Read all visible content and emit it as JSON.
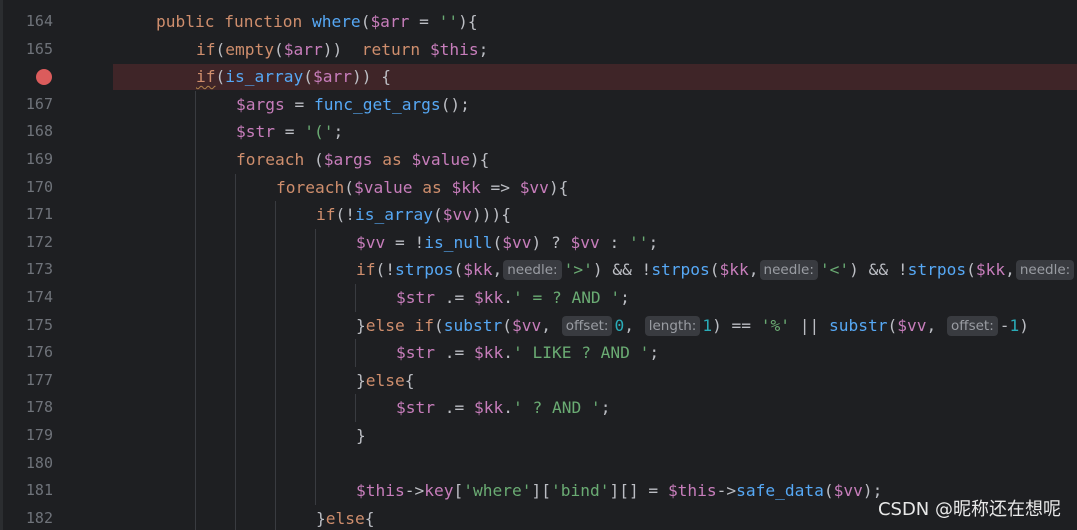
{
  "watermark": "CSDN @昵称还在想呢",
  "colors": {
    "background": "#1e1f22",
    "keyword": "#cf8e6d",
    "function": "#56a8f5",
    "variable": "#c77dbb",
    "string": "#6aab73",
    "number": "#2aacb8",
    "text": "#bcbec4",
    "line_number": "#6f737a",
    "breakpoint": "#db5c5c",
    "breakpoint_line_bg": "#3f2528",
    "inlay_hint_bg": "#393b40"
  },
  "icons": {
    "breakpoint": "breakpoint-dot-icon"
  },
  "lines": [
    {
      "num": "164",
      "indent": 1,
      "tokens": [
        [
          "kw",
          "public "
        ],
        [
          "kw",
          "function "
        ],
        [
          "fn",
          "where"
        ],
        [
          "punc",
          "("
        ],
        [
          "var",
          "$arr"
        ],
        [
          "punc",
          " = "
        ],
        [
          "str",
          "''"
        ],
        [
          "punc",
          "){"
        ]
      ]
    },
    {
      "num": "165",
      "indent": 2,
      "tokens": [
        [
          "kw",
          "if"
        ],
        [
          "punc",
          "("
        ],
        [
          "kw",
          "empty"
        ],
        [
          "punc",
          "("
        ],
        [
          "var",
          "$arr"
        ],
        [
          "punc",
          "))  "
        ],
        [
          "kw",
          "return "
        ],
        [
          "var",
          "$this"
        ],
        [
          "punc",
          ";"
        ]
      ]
    },
    {
      "num": "",
      "breakpoint": true,
      "indent": 2,
      "tokens": [
        [
          "kwsq",
          "if"
        ],
        [
          "punc",
          "("
        ],
        [
          "fn",
          "is_array"
        ],
        [
          "punc",
          "("
        ],
        [
          "var",
          "$arr"
        ],
        [
          "punc",
          ")) {"
        ]
      ]
    },
    {
      "num": "167",
      "indent": 3,
      "tokens": [
        [
          "var",
          "$args"
        ],
        [
          "punc",
          " = "
        ],
        [
          "fn",
          "func_get_args"
        ],
        [
          "punc",
          "();"
        ]
      ]
    },
    {
      "num": "168",
      "indent": 3,
      "tokens": [
        [
          "var",
          "$str"
        ],
        [
          "punc",
          " = "
        ],
        [
          "str",
          "'('"
        ],
        [
          "punc",
          ";"
        ]
      ]
    },
    {
      "num": "169",
      "indent": 3,
      "tokens": [
        [
          "kw",
          "foreach "
        ],
        [
          "punc",
          "("
        ],
        [
          "var",
          "$args"
        ],
        [
          "kw",
          " as "
        ],
        [
          "var",
          "$value"
        ],
        [
          "punc",
          "){"
        ]
      ]
    },
    {
      "num": "170",
      "indent": 4,
      "tokens": [
        [
          "kw",
          "foreach"
        ],
        [
          "punc",
          "("
        ],
        [
          "var",
          "$value"
        ],
        [
          "kw",
          " as "
        ],
        [
          "var",
          "$kk"
        ],
        [
          "punc",
          " => "
        ],
        [
          "var",
          "$vv"
        ],
        [
          "punc",
          "){"
        ]
      ]
    },
    {
      "num": "171",
      "indent": 5,
      "tokens": [
        [
          "kw",
          "if"
        ],
        [
          "punc",
          "(!"
        ],
        [
          "fn",
          "is_array"
        ],
        [
          "punc",
          "("
        ],
        [
          "var",
          "$vv"
        ],
        [
          "punc",
          "))){"
        ]
      ]
    },
    {
      "num": "172",
      "indent": 6,
      "tokens": [
        [
          "var",
          "$vv"
        ],
        [
          "punc",
          " = !"
        ],
        [
          "fn",
          "is_null"
        ],
        [
          "punc",
          "("
        ],
        [
          "var",
          "$vv"
        ],
        [
          "punc",
          ") ? "
        ],
        [
          "var",
          "$vv"
        ],
        [
          "punc",
          " : "
        ],
        [
          "str",
          "''"
        ],
        [
          "punc",
          ";"
        ]
      ]
    },
    {
      "num": "173",
      "indent": 6,
      "tokens": [
        [
          "kw",
          "if"
        ],
        [
          "punc",
          "(!"
        ],
        [
          "fn",
          "strpos"
        ],
        [
          "punc",
          "("
        ],
        [
          "var",
          "$kk"
        ],
        [
          "punc",
          ","
        ],
        [
          "hint",
          "needle:"
        ],
        [
          "str",
          "'>'"
        ],
        [
          "punc",
          ") && !"
        ],
        [
          "fn",
          "strpos"
        ],
        [
          "punc",
          "("
        ],
        [
          "var",
          "$kk"
        ],
        [
          "punc",
          ","
        ],
        [
          "hint",
          "needle:"
        ],
        [
          "str",
          "'<'"
        ],
        [
          "punc",
          ") && !"
        ],
        [
          "fn",
          "strpos"
        ],
        [
          "punc",
          "("
        ],
        [
          "var",
          "$kk"
        ],
        [
          "punc",
          ","
        ],
        [
          "hint",
          "needle:"
        ]
      ]
    },
    {
      "num": "174",
      "indent": 7,
      "tokens": [
        [
          "var",
          "$str"
        ],
        [
          "punc",
          " .= "
        ],
        [
          "var",
          "$kk"
        ],
        [
          "punc",
          "."
        ],
        [
          "str",
          "' = ? AND '"
        ],
        [
          "punc",
          ";"
        ]
      ]
    },
    {
      "num": "175",
      "indent": 6,
      "tokens": [
        [
          "punc",
          "}"
        ],
        [
          "kw",
          "else if"
        ],
        [
          "punc",
          "("
        ],
        [
          "fn",
          "substr"
        ],
        [
          "punc",
          "("
        ],
        [
          "var",
          "$vv"
        ],
        [
          "punc",
          ", "
        ],
        [
          "hint",
          "offset:"
        ],
        [
          "num",
          "0"
        ],
        [
          "punc",
          ", "
        ],
        [
          "hint",
          "length:"
        ],
        [
          "num",
          "1"
        ],
        [
          "punc",
          ") == "
        ],
        [
          "str",
          "'%'"
        ],
        [
          "punc",
          " || "
        ],
        [
          "fn",
          "substr"
        ],
        [
          "punc",
          "("
        ],
        [
          "var",
          "$vv"
        ],
        [
          "punc",
          ", "
        ],
        [
          "hint",
          "offset:"
        ],
        [
          "punc",
          "-"
        ],
        [
          "num",
          "1"
        ],
        [
          "punc",
          ")"
        ]
      ]
    },
    {
      "num": "176",
      "indent": 7,
      "tokens": [
        [
          "var",
          "$str"
        ],
        [
          "punc",
          " .= "
        ],
        [
          "var",
          "$kk"
        ],
        [
          "punc",
          "."
        ],
        [
          "str",
          "' LIKE ? AND '"
        ],
        [
          "punc",
          ";"
        ]
      ]
    },
    {
      "num": "177",
      "indent": 6,
      "tokens": [
        [
          "punc",
          "}"
        ],
        [
          "kw",
          "else"
        ],
        [
          "punc",
          "{"
        ]
      ]
    },
    {
      "num": "178",
      "indent": 7,
      "tokens": [
        [
          "var",
          "$str"
        ],
        [
          "punc",
          " .= "
        ],
        [
          "var",
          "$kk"
        ],
        [
          "punc",
          "."
        ],
        [
          "str",
          "' ? AND '"
        ],
        [
          "punc",
          ";"
        ]
      ]
    },
    {
      "num": "179",
      "indent": 6,
      "tokens": [
        [
          "punc",
          "}"
        ]
      ]
    },
    {
      "num": "180",
      "indent": 6,
      "tokens": []
    },
    {
      "num": "181",
      "indent": 6,
      "tokens": [
        [
          "var",
          "$this"
        ],
        [
          "punc",
          "->"
        ],
        [
          "prop",
          "key"
        ],
        [
          "punc",
          "["
        ],
        [
          "str",
          "'where'"
        ],
        [
          "punc",
          "]["
        ],
        [
          "str",
          "'bind'"
        ],
        [
          "punc",
          "][] = "
        ],
        [
          "var",
          "$this"
        ],
        [
          "punc",
          "->"
        ],
        [
          "fn",
          "safe_data"
        ],
        [
          "punc",
          "("
        ],
        [
          "var",
          "$vv"
        ],
        [
          "punc",
          ");"
        ]
      ]
    },
    {
      "num": "182",
      "indent": 5,
      "tokens": [
        [
          "punc",
          "}"
        ],
        [
          "kw",
          "else"
        ],
        [
          "punc",
          "{"
        ]
      ]
    }
  ]
}
